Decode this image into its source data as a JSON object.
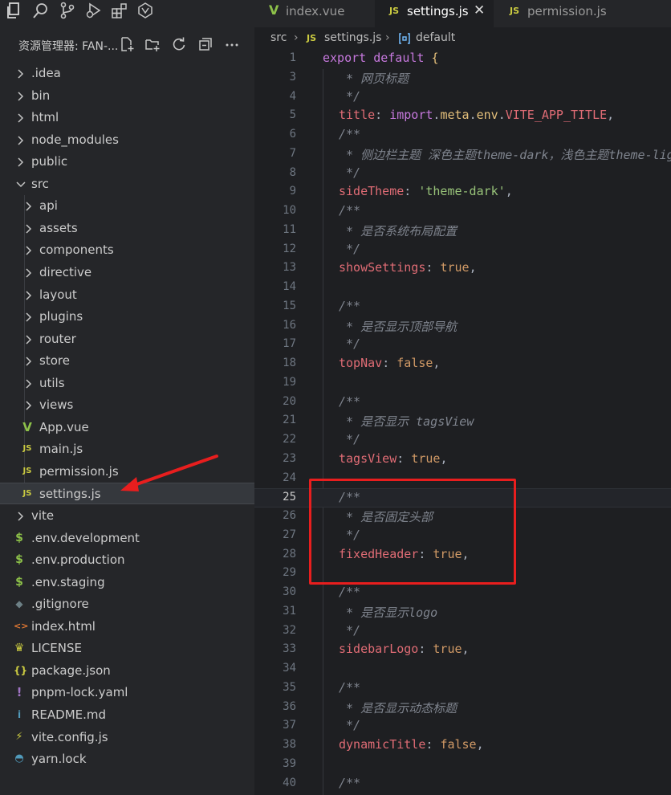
{
  "sidebar": {
    "explorer_title": "资源管理器: FAN-...",
    "tree": [
      {
        "label": ".idea",
        "type": "folder",
        "depth": 0,
        "expanded": false
      },
      {
        "label": "bin",
        "type": "folder",
        "depth": 0,
        "expanded": false
      },
      {
        "label": "html",
        "type": "folder",
        "depth": 0,
        "expanded": false
      },
      {
        "label": "node_modules",
        "type": "folder",
        "depth": 0,
        "expanded": false
      },
      {
        "label": "public",
        "type": "folder",
        "depth": 0,
        "expanded": false
      },
      {
        "label": "src",
        "type": "folder",
        "depth": 0,
        "expanded": true
      },
      {
        "label": "api",
        "type": "folder",
        "depth": 1,
        "expanded": false
      },
      {
        "label": "assets",
        "type": "folder",
        "depth": 1,
        "expanded": false
      },
      {
        "label": "components",
        "type": "folder",
        "depth": 1,
        "expanded": false
      },
      {
        "label": "directive",
        "type": "folder",
        "depth": 1,
        "expanded": false
      },
      {
        "label": "layout",
        "type": "folder",
        "depth": 1,
        "expanded": false
      },
      {
        "label": "plugins",
        "type": "folder",
        "depth": 1,
        "expanded": false
      },
      {
        "label": "router",
        "type": "folder",
        "depth": 1,
        "expanded": false
      },
      {
        "label": "store",
        "type": "folder",
        "depth": 1,
        "expanded": false
      },
      {
        "label": "utils",
        "type": "folder",
        "depth": 1,
        "expanded": false
      },
      {
        "label": "views",
        "type": "folder",
        "depth": 1,
        "expanded": false
      },
      {
        "label": "App.vue",
        "type": "vue",
        "depth": 1
      },
      {
        "label": "main.js",
        "type": "js",
        "depth": 1
      },
      {
        "label": "permission.js",
        "type": "js",
        "depth": 1
      },
      {
        "label": "settings.js",
        "type": "js",
        "depth": 1,
        "selected": true
      },
      {
        "label": "vite",
        "type": "folder",
        "depth": 0,
        "expanded": false
      },
      {
        "label": ".env.development",
        "type": "env",
        "depth": 0
      },
      {
        "label": ".env.production",
        "type": "env",
        "depth": 0
      },
      {
        "label": ".env.staging",
        "type": "env",
        "depth": 0
      },
      {
        "label": ".gitignore",
        "type": "git",
        "depth": 0
      },
      {
        "label": "index.html",
        "type": "html",
        "depth": 0
      },
      {
        "label": "LICENSE",
        "type": "license",
        "depth": 0
      },
      {
        "label": "package.json",
        "type": "json",
        "depth": 0
      },
      {
        "label": "pnpm-lock.yaml",
        "type": "yaml",
        "depth": 0
      },
      {
        "label": "README.md",
        "type": "info",
        "depth": 0
      },
      {
        "label": "vite.config.js",
        "type": "vite",
        "depth": 0
      },
      {
        "label": "yarn.lock",
        "type": "yarn",
        "depth": 0
      }
    ]
  },
  "tabs": [
    {
      "label": "index.vue",
      "type": "vue",
      "active": false
    },
    {
      "label": "settings.js",
      "type": "js",
      "active": true
    },
    {
      "label": "permission.js",
      "type": "js",
      "active": false
    }
  ],
  "file_icon_glyphs": {
    "js": "JS",
    "vue": "V"
  },
  "breadcrumb": {
    "parts": [
      "src",
      "settings.js",
      "default"
    ]
  },
  "code": [
    {
      "n": "1",
      "tokens": [
        [
          "kw",
          "export "
        ],
        [
          "kw",
          "default "
        ],
        [
          "brace",
          "{"
        ]
      ]
    },
    {
      "n": "3",
      "tokens": [
        [
          "cm",
          " * 网页标题"
        ]
      ]
    },
    {
      "n": "4",
      "tokens": [
        [
          "cm",
          " */"
        ]
      ]
    },
    {
      "n": "5",
      "tokens": [
        [
          "prop",
          "title"
        ],
        [
          "punct",
          ": "
        ],
        [
          "kw",
          "import"
        ],
        [
          "punct",
          "."
        ],
        [
          "mem",
          "meta"
        ],
        [
          "punct",
          "."
        ],
        [
          "mem",
          "env"
        ],
        [
          "punct",
          "."
        ],
        [
          "const",
          "VITE_APP_TITLE"
        ],
        [
          "punct",
          ","
        ]
      ]
    },
    {
      "n": "6",
      "tokens": [
        [
          "cm",
          "/**"
        ]
      ]
    },
    {
      "n": "7",
      "tokens": [
        [
          "cm",
          " * 侧边栏主题 深色主题theme-dark，浅色主题theme-light"
        ]
      ]
    },
    {
      "n": "8",
      "tokens": [
        [
          "cm",
          " */"
        ]
      ]
    },
    {
      "n": "9",
      "tokens": [
        [
          "prop",
          "sideTheme"
        ],
        [
          "punct",
          ": "
        ],
        [
          "str",
          "'theme-dark'"
        ],
        [
          "punct",
          ","
        ]
      ]
    },
    {
      "n": "10",
      "tokens": [
        [
          "cm",
          "/**"
        ]
      ]
    },
    {
      "n": "11",
      "tokens": [
        [
          "cm",
          " * 是否系统布局配置"
        ]
      ]
    },
    {
      "n": "12",
      "tokens": [
        [
          "cm",
          " */"
        ]
      ]
    },
    {
      "n": "13",
      "tokens": [
        [
          "prop",
          "showSettings"
        ],
        [
          "punct",
          ": "
        ],
        [
          "bool",
          "true"
        ],
        [
          "punct",
          ","
        ]
      ]
    },
    {
      "n": "14",
      "tokens": []
    },
    {
      "n": "15",
      "tokens": [
        [
          "cm",
          "/**"
        ]
      ]
    },
    {
      "n": "16",
      "tokens": [
        [
          "cm",
          " * 是否显示顶部导航"
        ]
      ]
    },
    {
      "n": "17",
      "tokens": [
        [
          "cm",
          " */"
        ]
      ]
    },
    {
      "n": "18",
      "tokens": [
        [
          "prop",
          "topNav"
        ],
        [
          "punct",
          ": "
        ],
        [
          "bool",
          "false"
        ],
        [
          "punct",
          ","
        ]
      ]
    },
    {
      "n": "19",
      "tokens": []
    },
    {
      "n": "20",
      "tokens": [
        [
          "cm",
          "/**"
        ]
      ]
    },
    {
      "n": "21",
      "tokens": [
        [
          "cm",
          " * 是否显示 tagsView"
        ]
      ]
    },
    {
      "n": "22",
      "tokens": [
        [
          "cm",
          " */"
        ]
      ]
    },
    {
      "n": "23",
      "tokens": [
        [
          "prop",
          "tagsView"
        ],
        [
          "punct",
          ": "
        ],
        [
          "bool",
          "true"
        ],
        [
          "punct",
          ","
        ]
      ]
    },
    {
      "n": "24",
      "tokens": []
    },
    {
      "n": "25",
      "tokens": [
        [
          "cm",
          "/**"
        ]
      ],
      "current": true
    },
    {
      "n": "26",
      "tokens": [
        [
          "cm",
          " * 是否固定头部"
        ]
      ]
    },
    {
      "n": "27",
      "tokens": [
        [
          "cm",
          " */"
        ]
      ]
    },
    {
      "n": "28",
      "tokens": [
        [
          "prop",
          "fixedHeader"
        ],
        [
          "punct",
          ": "
        ],
        [
          "bool",
          "true"
        ],
        [
          "punct",
          ","
        ]
      ]
    },
    {
      "n": "29",
      "tokens": []
    },
    {
      "n": "30",
      "tokens": [
        [
          "cm",
          "/**"
        ]
      ]
    },
    {
      "n": "31",
      "tokens": [
        [
          "cm",
          " * 是否显示logo"
        ]
      ]
    },
    {
      "n": "32",
      "tokens": [
        [
          "cm",
          " */"
        ]
      ]
    },
    {
      "n": "33",
      "tokens": [
        [
          "prop",
          "sidebarLogo"
        ],
        [
          "punct",
          ": "
        ],
        [
          "bool",
          "true"
        ],
        [
          "punct",
          ","
        ]
      ]
    },
    {
      "n": "34",
      "tokens": []
    },
    {
      "n": "35",
      "tokens": [
        [
          "cm",
          "/**"
        ]
      ]
    },
    {
      "n": "36",
      "tokens": [
        [
          "cm",
          " * 是否显示动态标题"
        ]
      ]
    },
    {
      "n": "37",
      "tokens": [
        [
          "cm",
          " */"
        ]
      ]
    },
    {
      "n": "38",
      "tokens": [
        [
          "prop",
          "dynamicTitle"
        ],
        [
          "punct",
          ": "
        ],
        [
          "bool",
          "false"
        ],
        [
          "punct",
          ","
        ]
      ]
    },
    {
      "n": "39",
      "tokens": []
    },
    {
      "n": "40",
      "tokens": [
        [
          "cm",
          "/**"
        ]
      ]
    }
  ]
}
